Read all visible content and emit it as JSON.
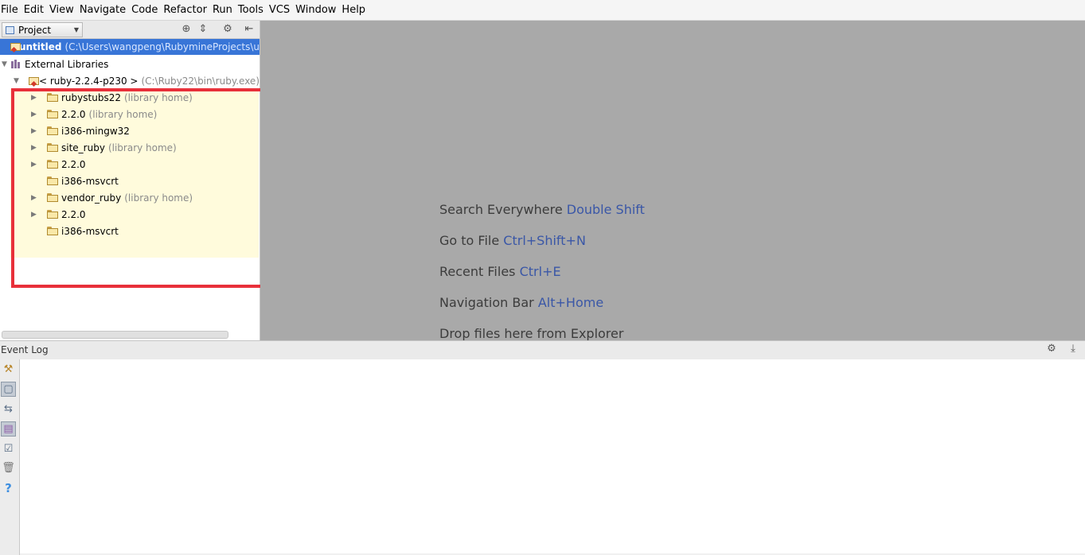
{
  "menu": [
    "File",
    "Edit",
    "View",
    "Navigate",
    "Code",
    "Refactor",
    "Run",
    "Tools",
    "VCS",
    "Window",
    "Help"
  ],
  "project_panel": {
    "view_label": "Project",
    "tree": [
      {
        "label": "untitled",
        "hint": "(C:\\Users\\wangpeng\\RubymineProjects\\u",
        "selected": true
      },
      {
        "label": "External Libraries",
        "hint": ""
      },
      {
        "label": "< ruby-2.2.4-p230 >",
        "hint": "(C:\\Ruby22\\bin\\ruby.exe)"
      },
      {
        "label": "rubystubs22",
        "hint": "(library home)"
      },
      {
        "label": "2.2.0",
        "hint": "(library home)"
      },
      {
        "label": "i386-mingw32",
        "hint": ""
      },
      {
        "label": "site_ruby",
        "hint": "(library home)"
      },
      {
        "label": "2.2.0",
        "hint": ""
      },
      {
        "label": "i386-msvcrt",
        "hint": ""
      },
      {
        "label": "vendor_ruby",
        "hint": "(library home)"
      },
      {
        "label": "2.2.0",
        "hint": ""
      },
      {
        "label": "i386-msvcrt",
        "hint": ""
      }
    ]
  },
  "editor_tips": [
    {
      "text": "Search Everywhere",
      "key": "Double Shift"
    },
    {
      "text": "Go to File",
      "key": "Ctrl+Shift+N"
    },
    {
      "text": "Recent Files",
      "key": "Ctrl+E"
    },
    {
      "text": "Navigation Bar",
      "key": "Alt+Home"
    },
    {
      "text": "Drop files here from Explorer",
      "key": ""
    }
  ],
  "event_log": {
    "title": "Event Log"
  },
  "colors": {
    "selection": "#3875d7",
    "highlight": "#fffbdc",
    "annotation_box": "#e8303a",
    "editor_bg": "#a9a9a9",
    "shortcut": "#3a57a7"
  }
}
